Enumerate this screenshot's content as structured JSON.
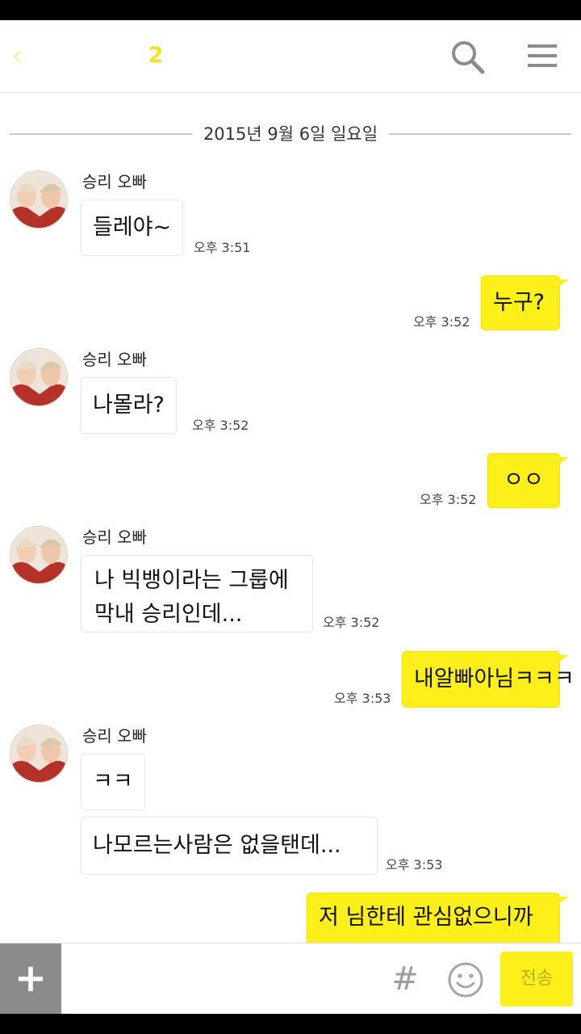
{
  "header": {
    "back_icon": "chevron-left-icon",
    "member_count": "2",
    "search_icon": "search-icon",
    "menu_icon": "menu-icon"
  },
  "chat": {
    "date_separator": "2015년 9월 6일 일요일",
    "messages": [
      {
        "from": "other",
        "sender": "승리 오빠",
        "bubbles": [
          "들레야~"
        ],
        "time": "오후 3:51"
      },
      {
        "from": "me",
        "bubbles": [
          "누구?"
        ],
        "time": "오후 3:52"
      },
      {
        "from": "other",
        "sender": "승리 오빠",
        "bubbles": [
          "나몰라?"
        ],
        "time": "오후 3:52"
      },
      {
        "from": "me",
        "bubbles": [
          "ㅇㅇ"
        ],
        "time": "오후 3:52"
      },
      {
        "from": "other",
        "sender": "승리 오빠",
        "bubbles": [
          "나 빅뱅이라는 그룹에\n막내 승리인데..."
        ],
        "time": "오후 3:52"
      },
      {
        "from": "me",
        "bubbles": [
          "내알빠아님ㅋㅋㅋ"
        ],
        "time": "오후 3:53"
      },
      {
        "from": "other",
        "sender": "승리 오빠",
        "bubbles": [
          "ㅋㅋ",
          "나모르는사람은 없을탠데..."
        ],
        "time": "오후 3:53"
      },
      {
        "from": "me",
        "bubbles": [
          "저 님한테 관심없으니까"
        ],
        "time": ""
      }
    ]
  },
  "input_bar": {
    "plus_label": "+",
    "placeholder": "",
    "hash_label": "#",
    "emoji_icon": "smiley-icon",
    "send_label": "전송"
  },
  "colors": {
    "my_bubble": "#fdf01a",
    "header_accent": "#f5e12a",
    "plus_button_bg": "#8b8b8b"
  }
}
